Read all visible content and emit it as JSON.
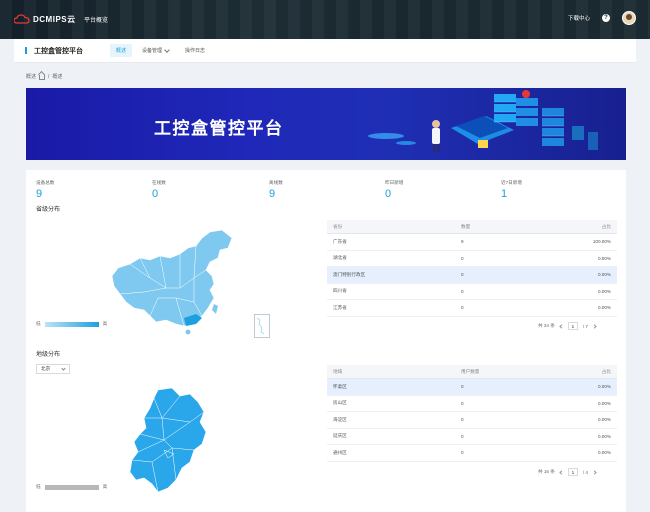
{
  "topbar": {
    "brand": "DCMIPS云",
    "nav_label": "平台概览",
    "download_label": "下载中心",
    "help_glyph": "?"
  },
  "subheader": {
    "title": "工控盒管控平台",
    "tabs": [
      {
        "label": "概述",
        "active": true
      },
      {
        "label": "设备管理",
        "active": false,
        "has_dropdown": true
      },
      {
        "label": "操作日志",
        "active": false
      }
    ]
  },
  "breadcrumb": {
    "root": "概述",
    "separator": "/",
    "current": "概述"
  },
  "banner": {
    "title": "工控盒管控平台"
  },
  "stats": [
    {
      "label": "设备总数",
      "value": "9"
    },
    {
      "label": "在线数",
      "value": "0"
    },
    {
      "label": "离线数",
      "value": "9"
    },
    {
      "label": "昨日新增",
      "value": "0"
    },
    {
      "label": "近7日新增",
      "value": "1"
    }
  ],
  "province_section": {
    "title": "省级分布",
    "legend_low": "低",
    "legend_high": "高",
    "table": {
      "headers": [
        "省份",
        "数量",
        "占比"
      ],
      "rows": [
        {
          "name": "广东省",
          "count": "9",
          "pct": "100.00%",
          "highlight": false
        },
        {
          "name": "湖北省",
          "count": "0",
          "pct": "0.00%",
          "highlight": false
        },
        {
          "name": "澳门特别行政区",
          "count": "0",
          "pct": "0.00%",
          "highlight": true
        },
        {
          "name": "四川省",
          "count": "0",
          "pct": "0.00%",
          "highlight": false
        },
        {
          "name": "江苏省",
          "count": "0",
          "pct": "0.00%",
          "highlight": false
        }
      ]
    },
    "pager": {
      "total": "共 34 条",
      "page": "1",
      "pages": "/ 7"
    }
  },
  "district_section": {
    "title": "地级分布",
    "select_value": "北京",
    "legend_low": "低",
    "legend_high": "高",
    "table": {
      "headers": [
        "地域",
        "用户数量",
        "占比"
      ],
      "rows": [
        {
          "name": "怀柔区",
          "count": "0",
          "pct": "0.00%",
          "highlight": true
        },
        {
          "name": "房山区",
          "count": "0",
          "pct": "0.00%",
          "highlight": false
        },
        {
          "name": "海淀区",
          "count": "0",
          "pct": "0.00%",
          "highlight": false
        },
        {
          "name": "延庆区",
          "count": "0",
          "pct": "0.00%",
          "highlight": false
        },
        {
          "name": "通州区",
          "count": "0",
          "pct": "0.00%",
          "highlight": false
        }
      ]
    },
    "pager": {
      "total": "共 16 条",
      "page": "1",
      "pages": "/ 4"
    }
  },
  "colors": {
    "accent": "#1aa0d8",
    "banner": "#1f27b8",
    "map_fill": "#7fc9f0",
    "map_dark": "#1e9fe0"
  }
}
